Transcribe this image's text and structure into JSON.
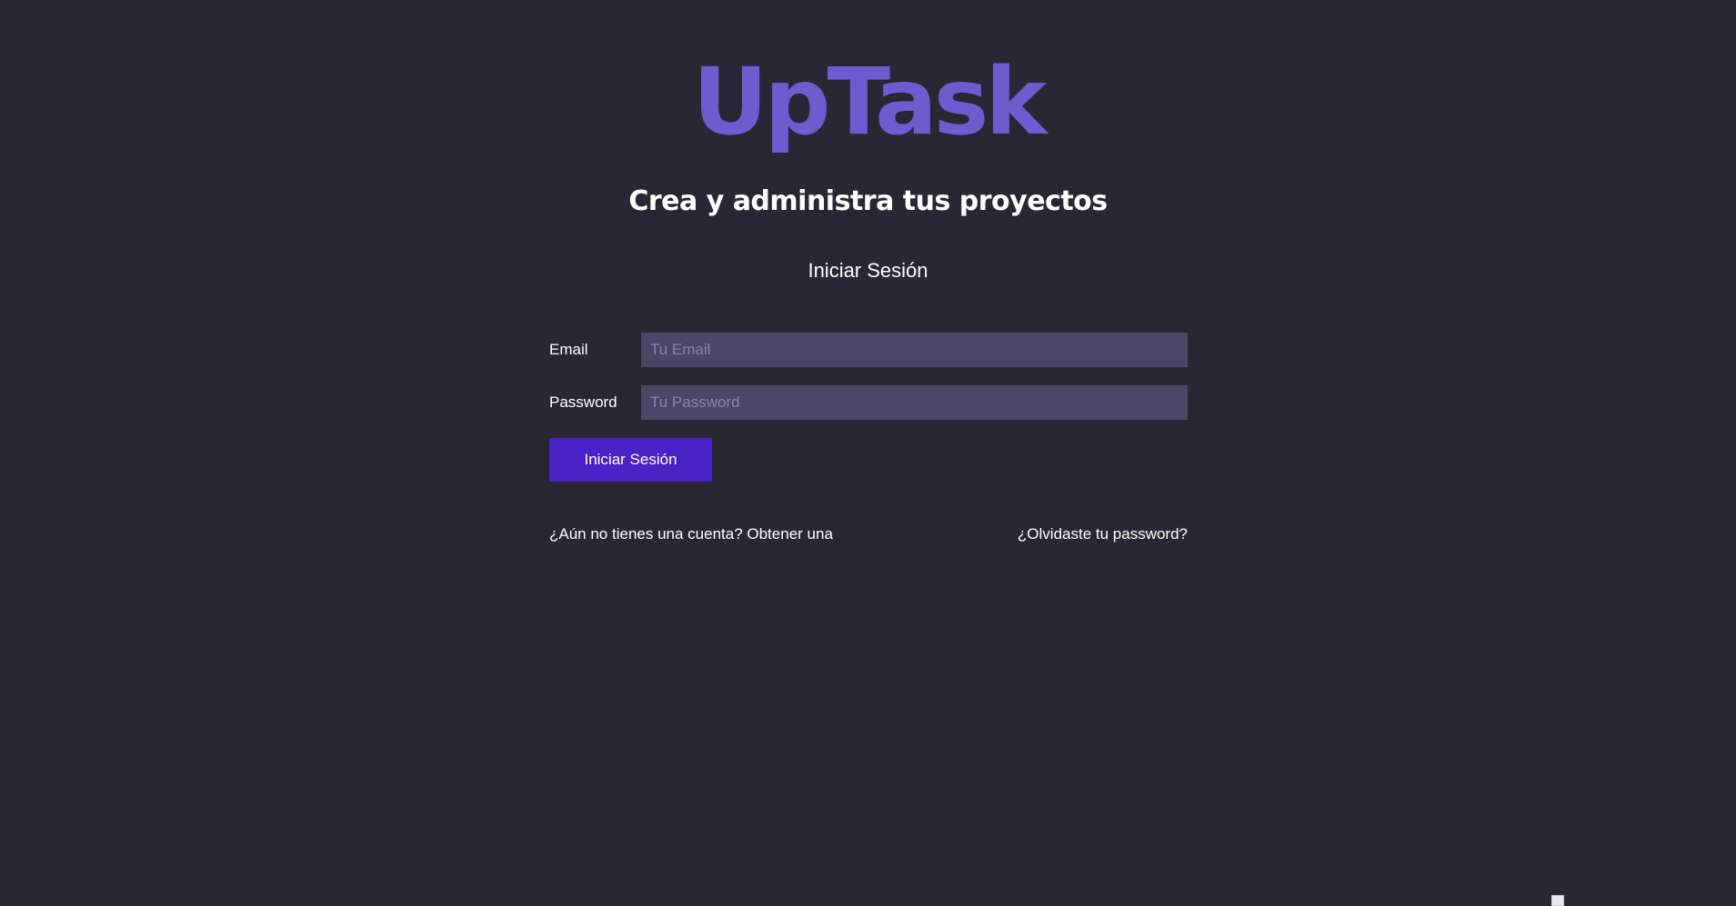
{
  "brand": {
    "logo_text": "UpTask",
    "tagline": "Crea y administra tus proyectos"
  },
  "login_form": {
    "title": "Iniciar Sesión",
    "email": {
      "label": "Email",
      "value": "",
      "placeholder": "Tu Email"
    },
    "password": {
      "label": "Password",
      "value": "",
      "placeholder": "Tu Password"
    },
    "submit_label": "Iniciar Sesión"
  },
  "footer_links": {
    "create_account": "¿Aún no tienes una cuenta? Obtener una",
    "forgot_password": "¿Olvidaste tu password?"
  },
  "colors": {
    "background": "#282835",
    "logo": "#6d5bd0",
    "input_background": "#494765",
    "button": "#4a22c5",
    "text": "#ffffff"
  },
  "icons": {
    "broken_image": "broken-image-icon"
  }
}
